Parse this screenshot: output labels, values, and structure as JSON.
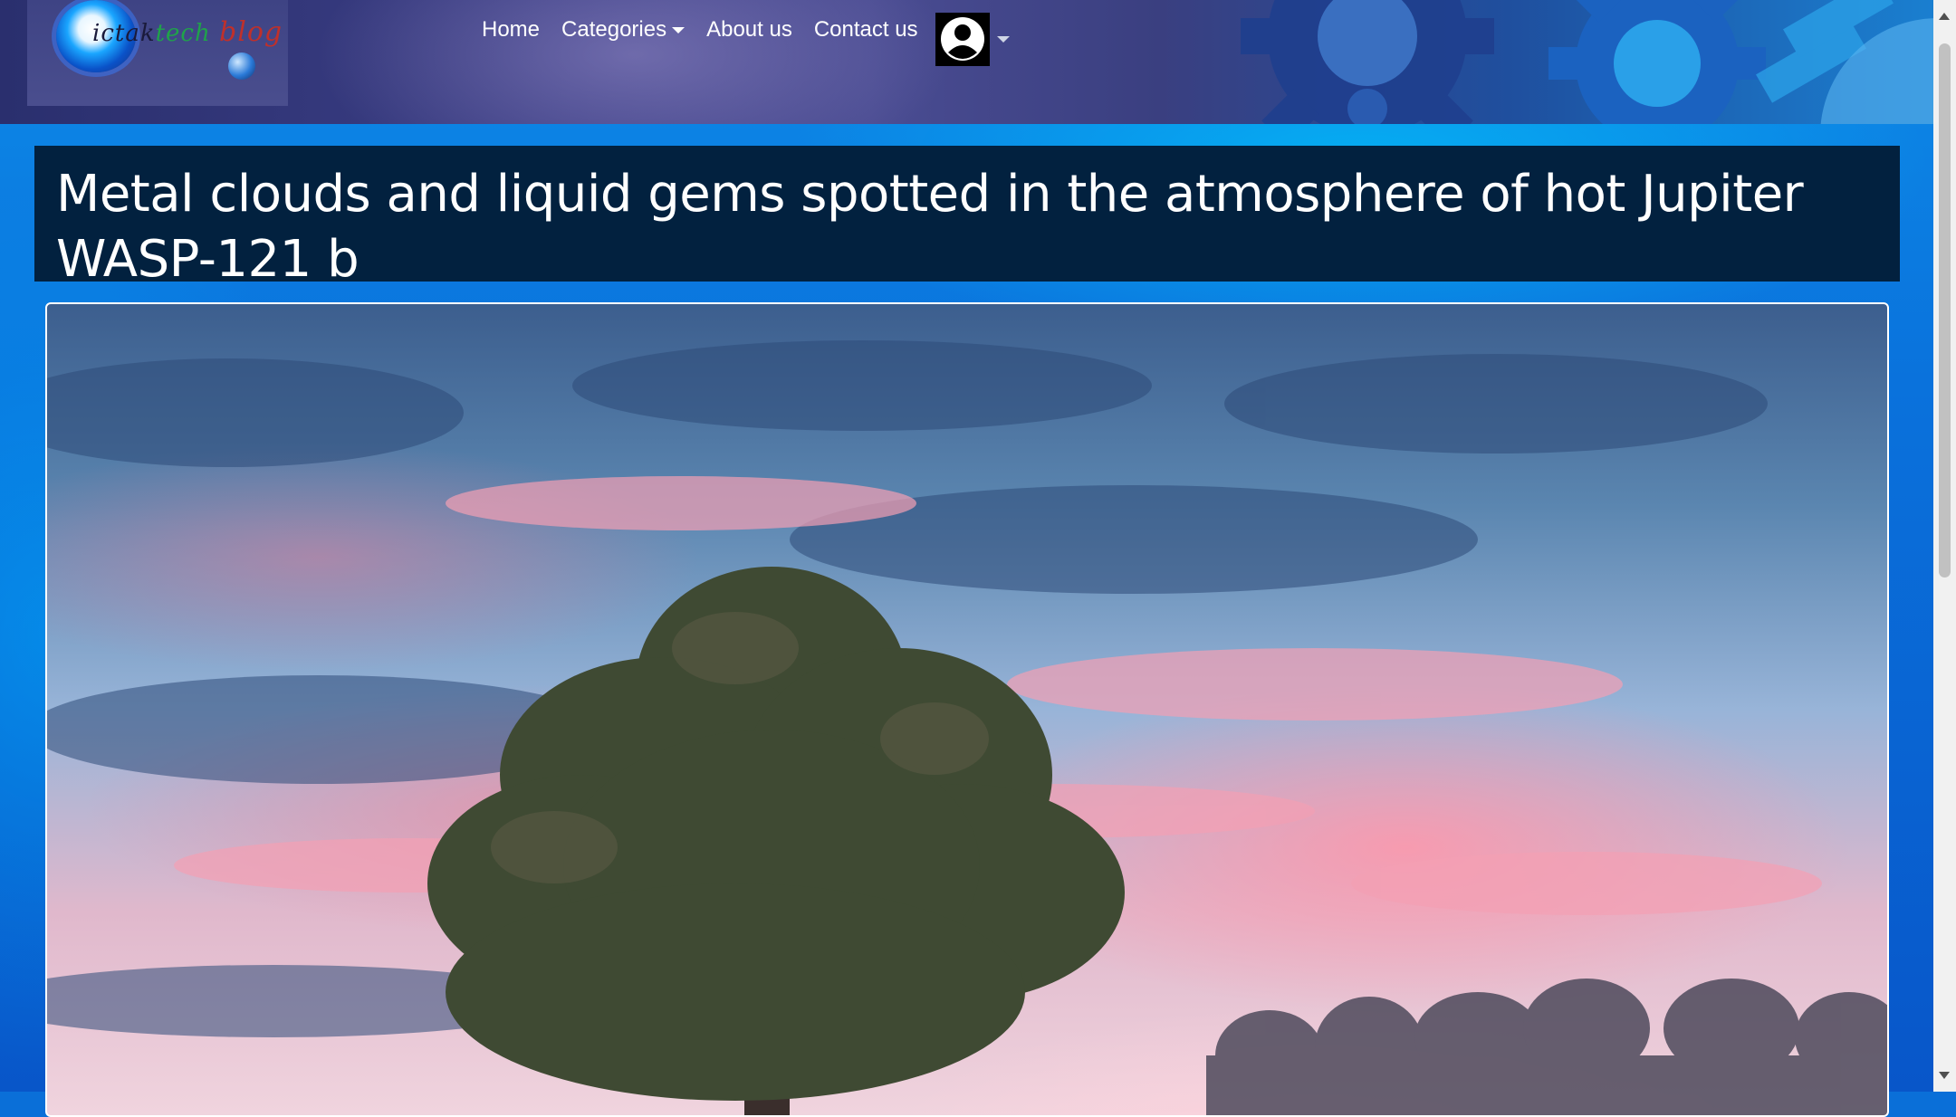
{
  "header": {
    "logo": {
      "text_1": "ictak",
      "text_2": "tech",
      "text_3": "blog"
    },
    "nav": [
      {
        "label": "Home"
      },
      {
        "label": "Categories"
      },
      {
        "label": "About us"
      },
      {
        "label": "Contact us"
      }
    ],
    "avatar_icon": "user-avatar-icon"
  },
  "article": {
    "title": "Metal clouds and liquid gems spotted in the atmosphere of hot Jupiter WASP-121 b",
    "hero_image": "sunset-tree-landscape"
  },
  "colors": {
    "header_bg": "#3c3f86",
    "title_bg": "#02213f",
    "page_bg": "#0a72dc",
    "nav_text": "#ffffff"
  }
}
